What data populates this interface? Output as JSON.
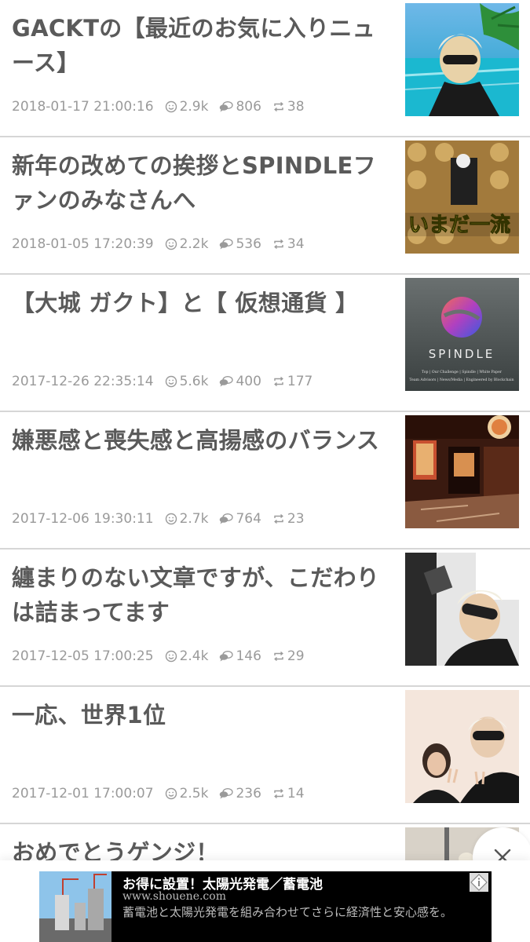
{
  "articles": [
    {
      "title": "GACKTの【最近のお気に入りニュース】",
      "date": "2018-01-17 21:00:16",
      "views": "2.9k",
      "comments": "806",
      "reposts": "38",
      "thumb": "sunglasses-man-by-pool"
    },
    {
      "title": "新年の改めての挨拶とSPINDLEファンのみなさんへ",
      "date": "2018-01-05 17:20:39",
      "views": "2.2k",
      "comments": "536",
      "reposts": "34",
      "thumb": "golden-wall-video-caption",
      "thumb_caption": "いまだ一流"
    },
    {
      "title": "【大城 ガクト】と【 仮想通貨 】",
      "date": "2017-12-26 22:35:14",
      "views": "5.6k",
      "comments": "400",
      "reposts": "177",
      "thumb": "spindle-logo",
      "thumb_caption": "SPINDLE",
      "thumb_menu": "Top | Our Challenge | Spindle | White Paper",
      "thumb_menu2": "Team Advisors | News/Media | Engineered by Blockchain"
    },
    {
      "title": "嫌悪感と喪失感と高揚感のバランス",
      "date": "2017-12-06 19:30:11",
      "views": "2.7k",
      "comments": "764",
      "reposts": "23",
      "thumb": "lantern-restaurant-interior"
    },
    {
      "title": "纏まりのない文章ですが、こだわりは詰まってます",
      "date": "2017-12-05 17:00:25",
      "views": "2.4k",
      "comments": "146",
      "reposts": "29",
      "thumb": "sunglasses-man-selfie"
    },
    {
      "title": "一応、世界1位",
      "date": "2017-12-01 17:00:07",
      "views": "2.5k",
      "comments": "236",
      "reposts": "14",
      "thumb": "two-people-peace-sign"
    },
    {
      "title": "おめでとうゲンジ！",
      "thumb": "partial-photo"
    }
  ],
  "ad": {
    "title": "お得に設置！太陽光発電／蓄電池",
    "url": "www.shouene.com",
    "description": "蓄電池と太陽光発電を組み合わせてさらに経済性と安心感を。",
    "icon": "info-icon"
  },
  "icons": {
    "views": "smile-icon",
    "comments": "speech-bubble-icon",
    "reposts": "repost-icon",
    "close": "close-icon"
  },
  "colors": {
    "title": "#5a5a5a",
    "meta": "#9a9a9a",
    "divider": "#d6d6d6",
    "ad_bg": "#000000"
  }
}
